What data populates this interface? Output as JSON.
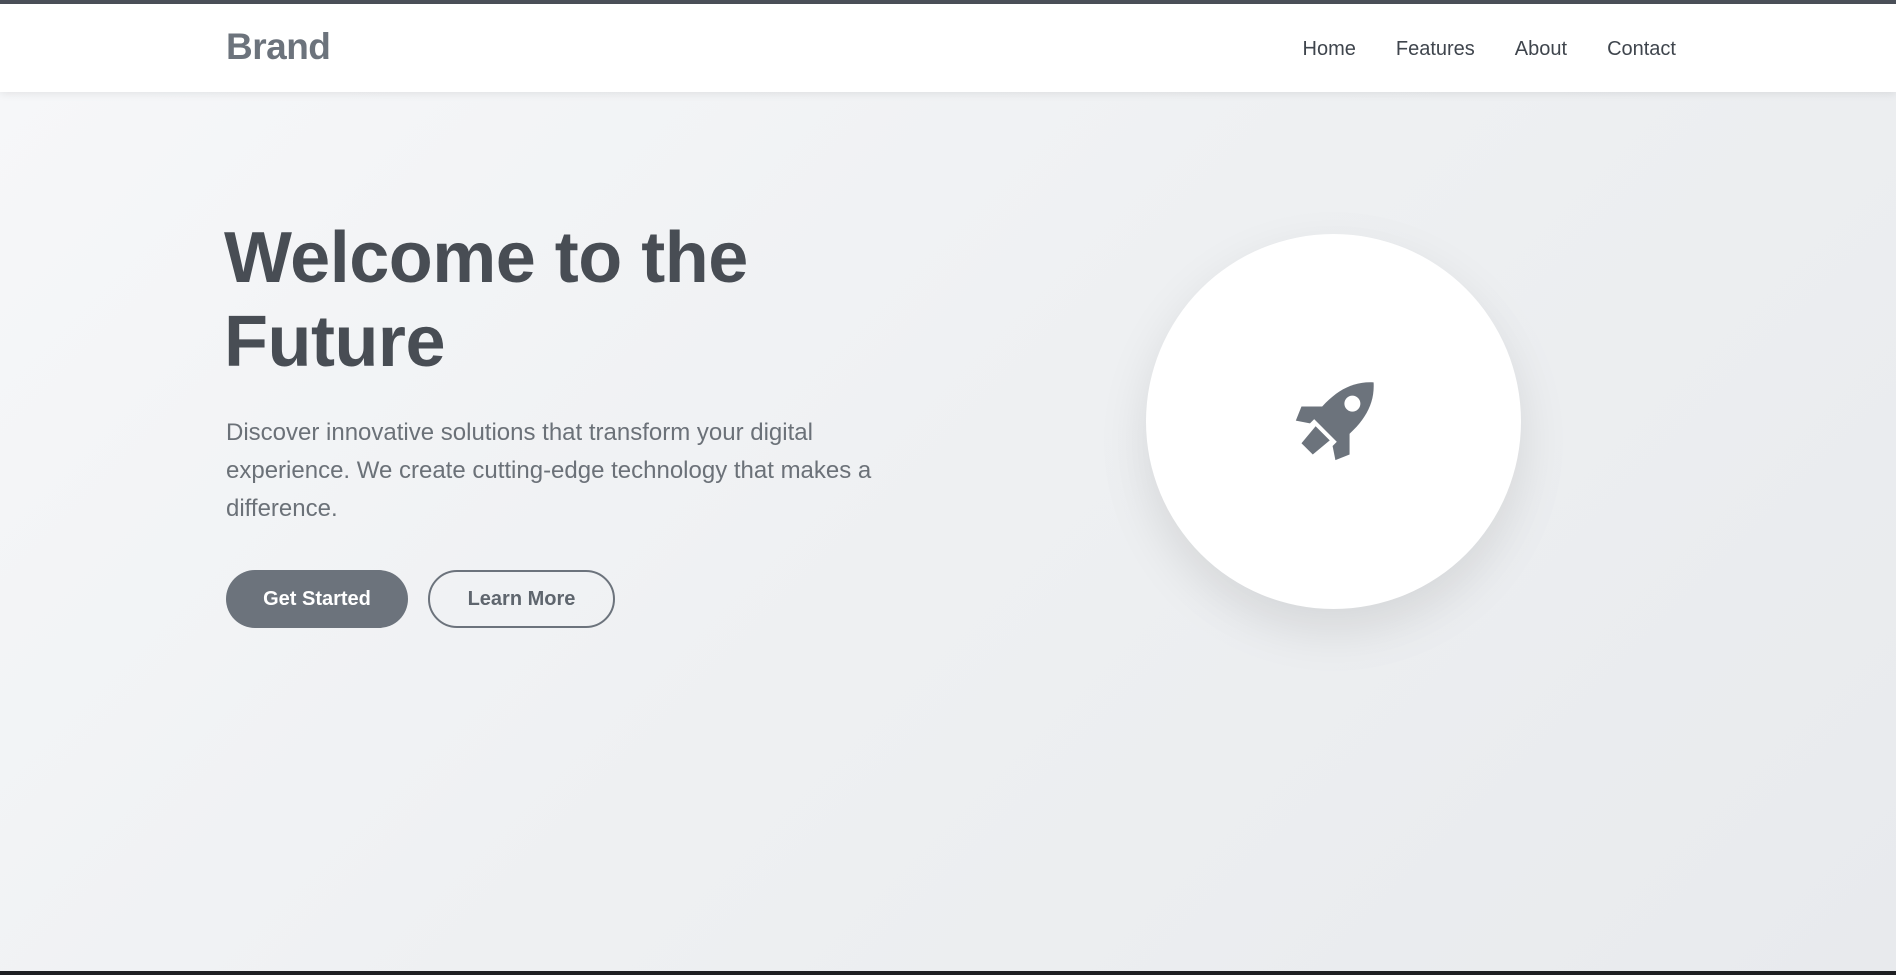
{
  "navbar": {
    "brand": "Brand",
    "links": [
      {
        "label": "Home"
      },
      {
        "label": "Features"
      },
      {
        "label": "About"
      },
      {
        "label": "Contact"
      }
    ]
  },
  "hero": {
    "title_line1": "Welcome to the",
    "title_line2": "Future",
    "description": "Discover innovative solutions that transform your digital experience. We create cutting-edge technology that makes a difference.",
    "primary_button": "Get Started",
    "secondary_button": "Learn More",
    "icon": "rocket-icon"
  },
  "colors": {
    "accent": "#6c737c",
    "title": "#484d54",
    "text": "#6b7178",
    "background": "#f0f1f3"
  }
}
